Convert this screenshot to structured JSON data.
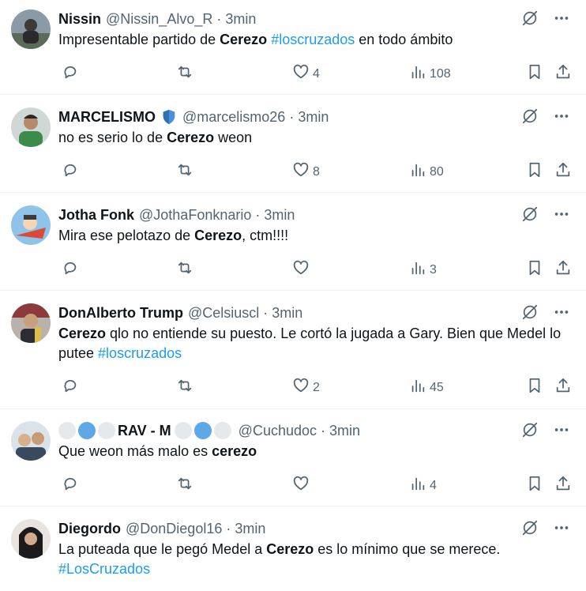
{
  "tweets": [
    {
      "name": "Nissin",
      "handle": "@Nissin_Alvo_R",
      "sep": "·",
      "time": "3min",
      "text": [
        {
          "t": "Impresentable partido de "
        },
        {
          "t": "Cerezo",
          "style": "bold"
        },
        {
          "t": " "
        },
        {
          "t": "#loscruzados",
          "style": "tag"
        },
        {
          "t": " en todo ámbito"
        }
      ],
      "likes": "4",
      "views": "108"
    },
    {
      "name": "MARCELISMO",
      "badge": "shield-icon",
      "handle": "@marcelismo26",
      "sep": "·",
      "time": "3min",
      "text": [
        {
          "t": "no es serio lo de "
        },
        {
          "t": "Cerezo",
          "style": "bold"
        },
        {
          "t": " weon"
        }
      ],
      "likes": "8",
      "views": "80"
    },
    {
      "name": "Jotha Fonk",
      "handle": "@JothaFonknario",
      "sep": "·",
      "time": "3min",
      "text": [
        {
          "t": "Mira ese pelotazo de "
        },
        {
          "t": "Cerezo",
          "style": "bold"
        },
        {
          "t": ", ctm!!!!"
        }
      ],
      "likes": "",
      "views": "3"
    },
    {
      "name": "DonAlberto Trump",
      "handle": "@Celsiuscl",
      "sep": "·",
      "time": "3min",
      "text": [
        {
          "t": "Cerezo",
          "style": "bold"
        },
        {
          "t": " qlo no entiende su puesto. Le cortó la jugada a Gary. Bien que Medel lo putee "
        },
        {
          "t": "#loscruzados",
          "style": "tag"
        }
      ],
      "likes": "2",
      "views": "45"
    },
    {
      "name": "RAV - M",
      "handle": "@Cuchudoc",
      "sep": "·",
      "time": "3min",
      "text": [
        {
          "t": "Que weon más malo es "
        },
        {
          "t": "cerezo",
          "style": "bold"
        }
      ],
      "likes": "",
      "views": "4"
    },
    {
      "name": "Diegordo",
      "handle": "@DonDiegol16",
      "sep": "·",
      "time": "3min",
      "text": [
        {
          "t": "La puteada que le pegó Medel a "
        },
        {
          "t": "Cerezo",
          "style": "bold"
        },
        {
          "t": " es lo mínimo que se merece. "
        },
        {
          "t": "#LosCruzados",
          "style": "tag"
        }
      ],
      "likes": "",
      "views": ""
    }
  ],
  "colors": {
    "text": "#0f1419",
    "secondary": "#536471",
    "hashtag": "#1d9bf0",
    "divider": "#eff3f4",
    "badge": "#4a90d9"
  },
  "icons": [
    "reply-icon",
    "retweet-icon",
    "like-icon",
    "views-icon",
    "bookmark-icon",
    "share-icon",
    "grok-icon",
    "more-icon"
  ]
}
